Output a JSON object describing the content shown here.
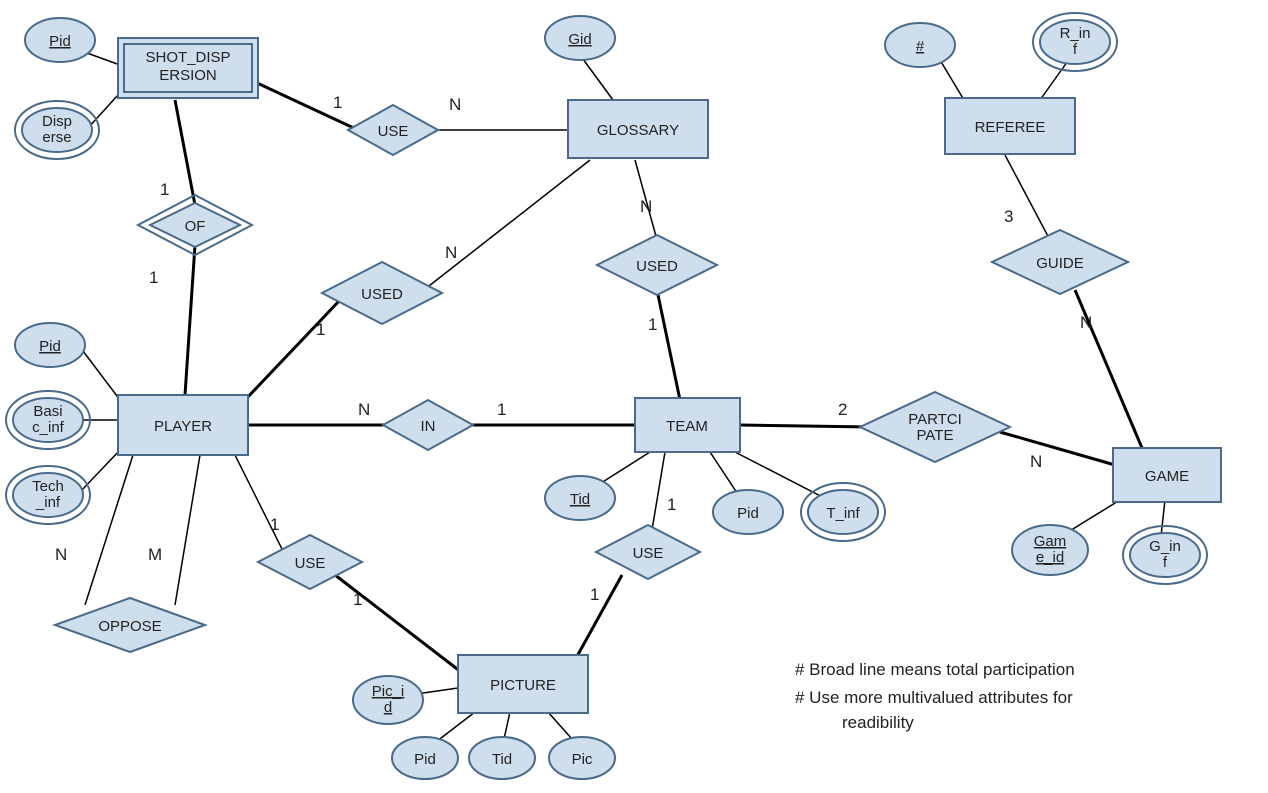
{
  "entities": {
    "shot_dispersion": "SHOT_DISPERSION",
    "glossary": "GLOSSARY",
    "referee": "REFEREE",
    "player": "PLAYER",
    "team": "TEAM",
    "game": "GAME",
    "picture": "PICTURE"
  },
  "relations": {
    "use_sd_gl": "USE",
    "of": "OF",
    "used_pl_gl": "USED",
    "used_tm_gl": "USED",
    "in": "IN",
    "participate": "PARTCIPATE",
    "guide": "GUIDE",
    "oppose": "OPPOSE",
    "use_pl_pic": "USE",
    "use_tm_pic": "USE"
  },
  "attributes": {
    "sd_pid": "Pid",
    "sd_disperse1": "Disp",
    "sd_disperse2": "erse",
    "gl_gid": "Gid",
    "ref_num": "#",
    "ref_inf1": "R_in",
    "ref_inf2": "f",
    "pl_pid": "Pid",
    "pl_basic1": "Basi",
    "pl_basic2": "c_inf",
    "pl_tech1": "Tech",
    "pl_tech2": "_inf",
    "tm_tid": "Tid",
    "tm_pid": "Pid",
    "tm_inf": "T_inf",
    "gm_id1": "Gam",
    "gm_id2": "e_id",
    "gm_inf1": "G_in",
    "gm_inf2": "f",
    "pic_id1": "Pic_i",
    "pic_id2": "d",
    "pic_pid": "Pid",
    "pic_tid": "Tid",
    "pic_pic": "Pic"
  },
  "cards": {
    "use_sd": "1",
    "use_gl": "N",
    "of_sd": "1",
    "of_pl": "1",
    "used_pl": "1",
    "used_gl_pl": "N",
    "used_tm": "1",
    "used_gl_tm": "N",
    "in_pl": "N",
    "in_tm": "1",
    "part_tm": "2",
    "part_gm": "N",
    "guide_ref": "3",
    "guide_gm": "N",
    "oppose_l": "N",
    "oppose_r": "M",
    "use_pl_pic_pl": "1",
    "use_pl_pic_pic": "1",
    "use_tm_pic_tm": "1",
    "use_tm_pic_pic": "1"
  },
  "notes": {
    "line1": "# Broad line means  total participation",
    "line2": "# Use more multivalued attributes for",
    "line3": "readibility"
  },
  "chart_data": {
    "type": "er-diagram",
    "entities": [
      {
        "name": "SHOT_DISPERSION",
        "weak": true,
        "attributes": [
          {
            "name": "Pid",
            "key": true
          },
          {
            "name": "Disperse",
            "multivalued": true
          }
        ]
      },
      {
        "name": "GLOSSARY",
        "attributes": [
          {
            "name": "Gid",
            "key": true
          }
        ]
      },
      {
        "name": "REFEREE",
        "attributes": [
          {
            "name": "#",
            "key": true
          },
          {
            "name": "R_inf",
            "multivalued": true
          }
        ]
      },
      {
        "name": "PLAYER",
        "attributes": [
          {
            "name": "Pid",
            "key": true
          },
          {
            "name": "Basic_inf",
            "multivalued": true
          },
          {
            "name": "Tech_inf",
            "multivalued": true
          }
        ]
      },
      {
        "name": "TEAM",
        "attributes": [
          {
            "name": "Tid",
            "key": true
          },
          {
            "name": "Pid"
          },
          {
            "name": "T_inf",
            "multivalued": true
          }
        ]
      },
      {
        "name": "GAME",
        "attributes": [
          {
            "name": "Game_id",
            "key": true
          },
          {
            "name": "G_inf",
            "multivalued": true
          }
        ]
      },
      {
        "name": "PICTURE",
        "attributes": [
          {
            "name": "Pic_id",
            "key": true
          },
          {
            "name": "Pid"
          },
          {
            "name": "Tid"
          },
          {
            "name": "Pic"
          }
        ]
      }
    ],
    "relationships": [
      {
        "name": "USE",
        "between": [
          "SHOT_DISPERSION",
          "GLOSSARY"
        ],
        "card": [
          "1",
          "N"
        ],
        "total": [
          "SHOT_DISPERSION"
        ]
      },
      {
        "name": "OF",
        "identifying": true,
        "between": [
          "SHOT_DISPERSION",
          "PLAYER"
        ],
        "card": [
          "1",
          "1"
        ],
        "total": [
          "SHOT_DISPERSION",
          "PLAYER"
        ]
      },
      {
        "name": "USED",
        "between": [
          "PLAYER",
          "GLOSSARY"
        ],
        "card": [
          "1",
          "N"
        ],
        "total": [
          "PLAYER"
        ]
      },
      {
        "name": "USED",
        "between": [
          "TEAM",
          "GLOSSARY"
        ],
        "card": [
          "1",
          "N"
        ],
        "total": [
          "TEAM"
        ]
      },
      {
        "name": "IN",
        "between": [
          "PLAYER",
          "TEAM"
        ],
        "card": [
          "N",
          "1"
        ],
        "total": [
          "PLAYER",
          "TEAM"
        ]
      },
      {
        "name": "PARTCIPATE",
        "between": [
          "TEAM",
          "GAME"
        ],
        "card": [
          "2",
          "N"
        ],
        "total": [
          "TEAM",
          "GAME"
        ]
      },
      {
        "name": "GUIDE",
        "between": [
          "REFEREE",
          "GAME"
        ],
        "card": [
          "3",
          "N"
        ],
        "total": [
          "GAME"
        ]
      },
      {
        "name": "OPPOSE",
        "between": [
          "PLAYER",
          "PLAYER"
        ],
        "card": [
          "N",
          "M"
        ]
      },
      {
        "name": "USE",
        "between": [
          "PLAYER",
          "PICTURE"
        ],
        "card": [
          "1",
          "1"
        ],
        "total": [
          "PICTURE"
        ]
      },
      {
        "name": "USE",
        "between": [
          "TEAM",
          "PICTURE"
        ],
        "card": [
          "1",
          "1"
        ],
        "total": [
          "PICTURE"
        ]
      }
    ],
    "notes": [
      "# Broad line means total participation",
      "# Use more multivalued attributes for readibility"
    ]
  }
}
